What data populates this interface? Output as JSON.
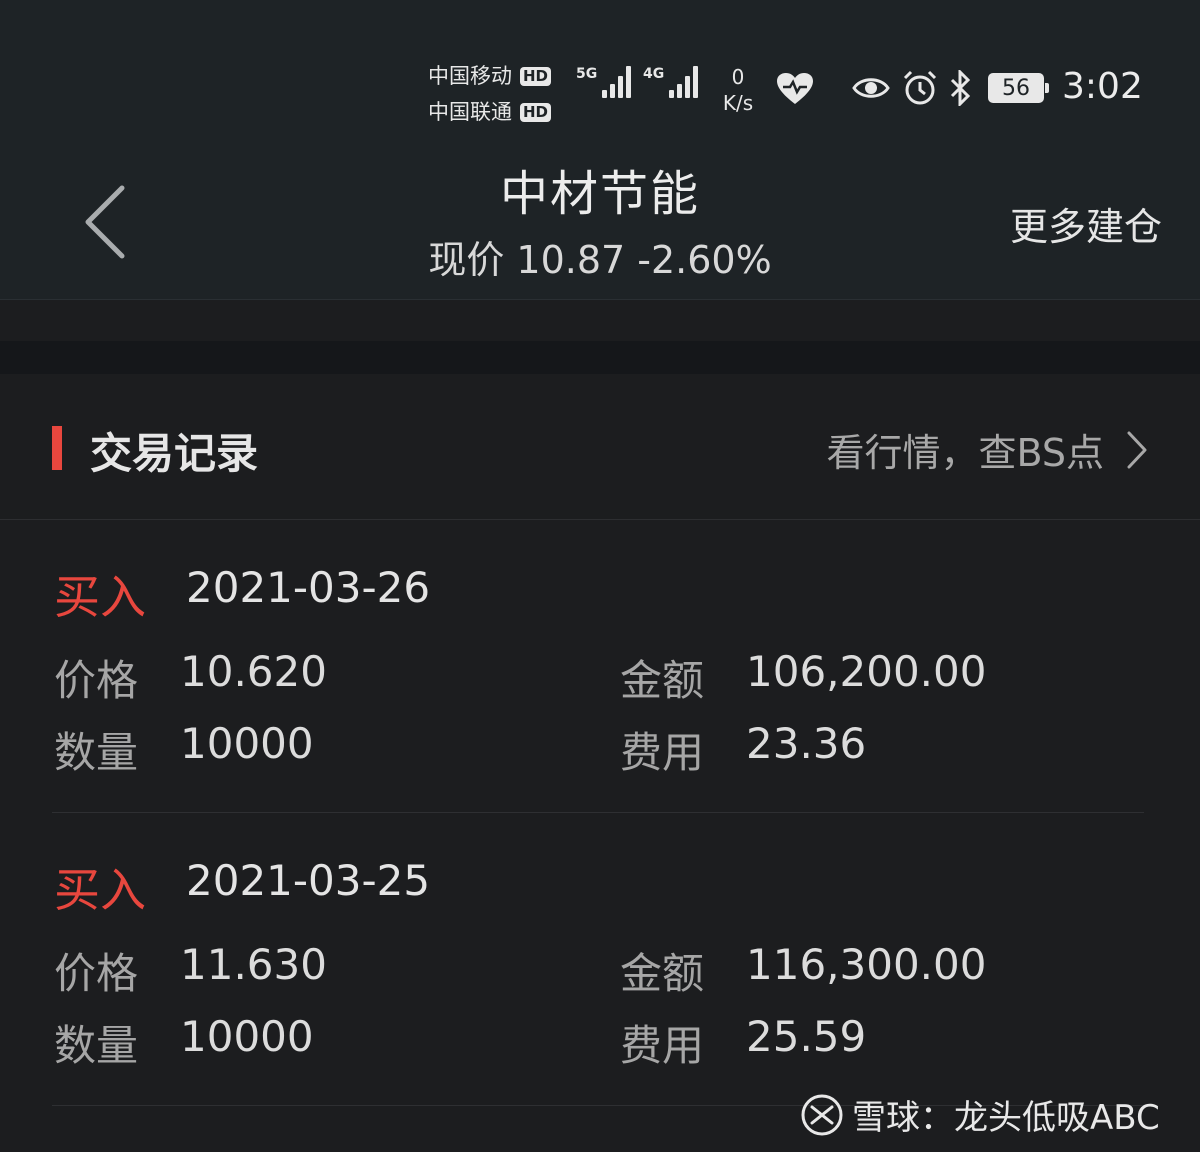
{
  "status_bar": {
    "carrier1": "中国移动",
    "carrier2": "中国联通",
    "hd_badge": "HD",
    "net1": "5G",
    "net2": "4G",
    "speed_value": "0",
    "speed_unit": "K/s",
    "battery": "56",
    "time": "3:02"
  },
  "header": {
    "title": "中材节能",
    "price_line": "现价 10.87 -2.60%",
    "more_button": "更多建仓"
  },
  "section": {
    "title": "交易记录",
    "link": "看行情，查BS点"
  },
  "records": [
    {
      "type": "买入",
      "date": "2021-03-26",
      "price_label": "价格",
      "price": "10.620",
      "amount_label": "金额",
      "amount": "106,200.00",
      "qty_label": "数量",
      "qty": "10000",
      "fee_label": "费用",
      "fee": "23.36"
    },
    {
      "type": "买入",
      "date": "2021-03-25",
      "price_label": "价格",
      "price": "11.630",
      "amount_label": "金额",
      "amount": "116,300.00",
      "qty_label": "数量",
      "qty": "10000",
      "fee_label": "费用",
      "fee": "25.59"
    }
  ],
  "watermark": "雪球：龙头低吸ABC",
  "colors": {
    "accent_red": "#e8473e",
    "bar_bg": "#1e2326",
    "page_bg": "#1c1d1f"
  }
}
